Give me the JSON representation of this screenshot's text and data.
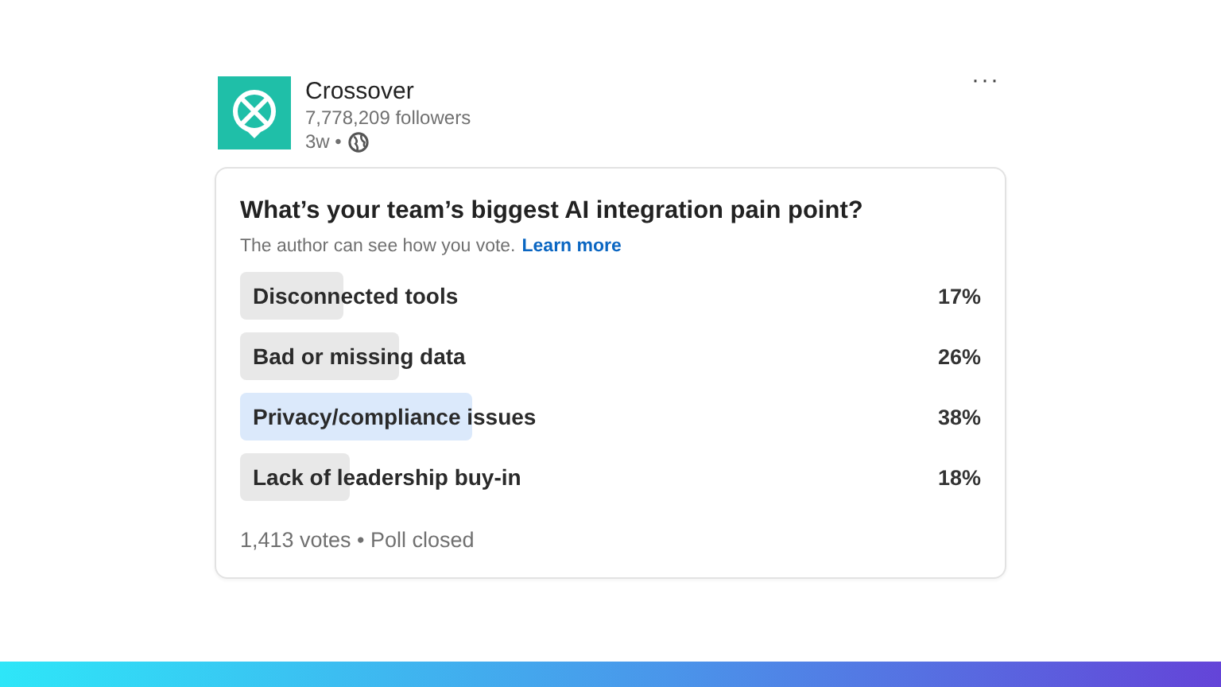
{
  "post": {
    "author": "Crossover",
    "followers": "7,778,209 followers",
    "age": "3w •",
    "more": "···"
  },
  "poll": {
    "question": "What’s your team’s biggest AI integration pain point?",
    "note": "The author can see how you vote.",
    "note_link": "Learn more",
    "options": [
      {
        "label": "Disconnected tools",
        "percent": "17%",
        "selected": false
      },
      {
        "label": "Bad or missing data",
        "percent": "26%",
        "selected": false
      },
      {
        "label": "Privacy/compliance issues",
        "percent": "38%",
        "selected": true
      },
      {
        "label": "Lack of leadership buy-in",
        "percent": "18%",
        "selected": false
      }
    ],
    "footer": "1,413 votes • Poll closed"
  }
}
